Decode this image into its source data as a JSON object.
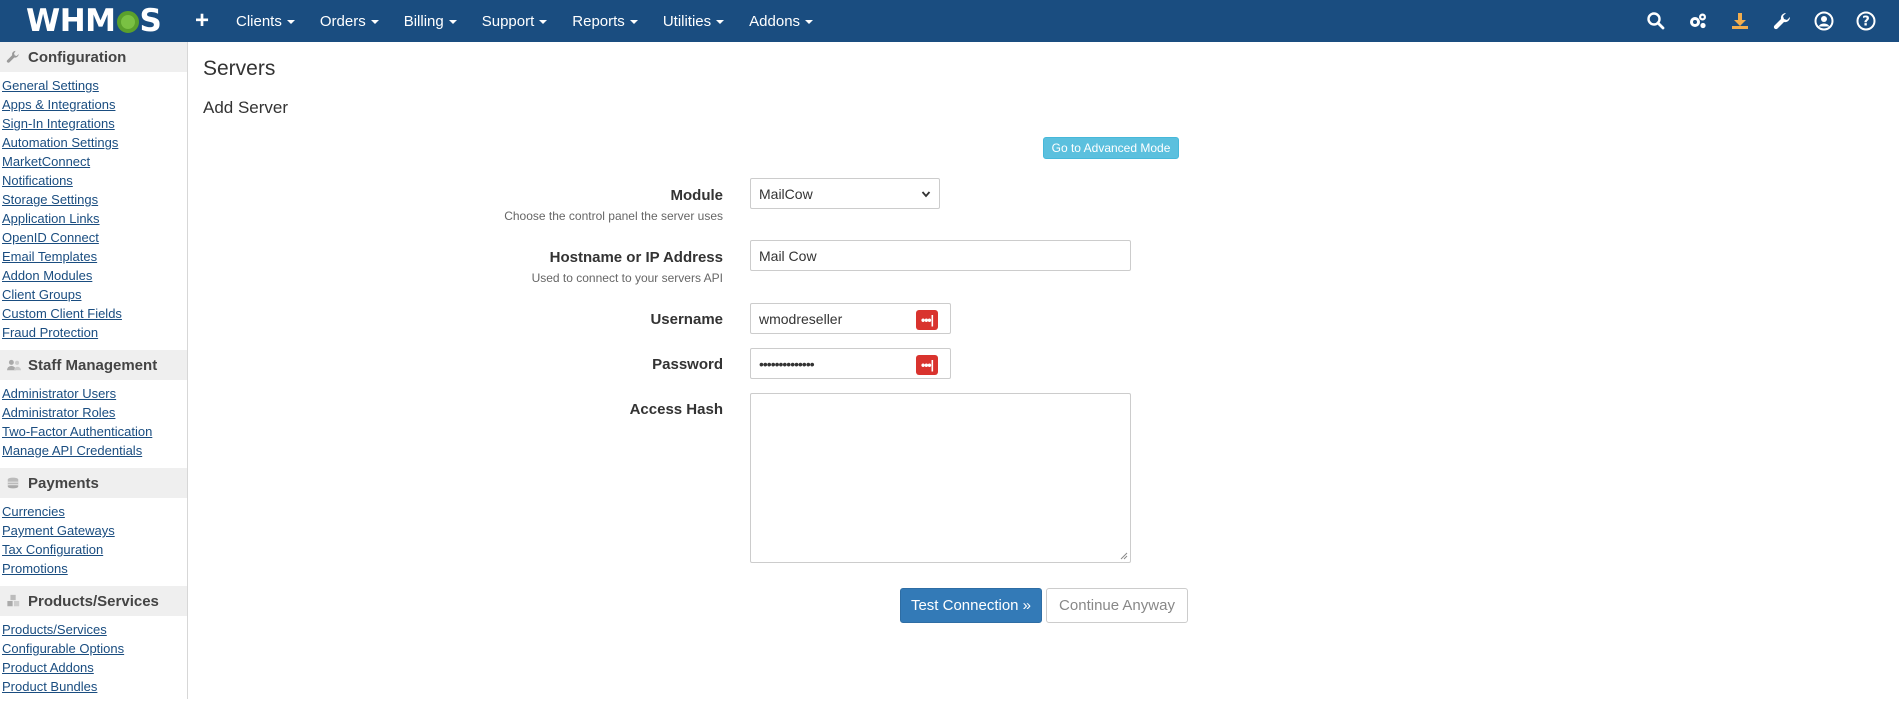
{
  "header": {
    "logo": {
      "prefix": "WHM",
      "suffix": "S"
    },
    "plus_icon": "plus-icon",
    "menu": [
      {
        "label": "Clients"
      },
      {
        "label": "Orders"
      },
      {
        "label": "Billing"
      },
      {
        "label": "Support"
      },
      {
        "label": "Reports"
      },
      {
        "label": "Utilities"
      },
      {
        "label": "Addons"
      }
    ],
    "icons": [
      "search-icon",
      "gears-icon",
      "download-icon",
      "wrench-icon",
      "user-icon",
      "help-icon"
    ]
  },
  "sidebar": {
    "sections": [
      {
        "title": "Configuration",
        "icon": "wrench-icon",
        "links": [
          "General Settings",
          "Apps & Integrations",
          "Sign-In Integrations",
          "Automation Settings",
          "MarketConnect",
          "Notifications",
          "Storage Settings",
          "Application Links",
          "OpenID Connect",
          "Email Templates",
          "Addon Modules",
          "Client Groups",
          "Custom Client Fields",
          "Fraud Protection"
        ]
      },
      {
        "title": "Staff Management",
        "icon": "users-icon",
        "links": [
          "Administrator Users",
          "Administrator Roles",
          "Two-Factor Authentication",
          "Manage API Credentials"
        ]
      },
      {
        "title": "Payments",
        "icon": "coins-icon",
        "links": [
          "Currencies",
          "Payment Gateways",
          "Tax Configuration",
          "Promotions"
        ]
      },
      {
        "title": "Products/Services",
        "icon": "cubes-icon",
        "links": [
          "Products/Services",
          "Configurable Options",
          "Product Addons",
          "Product Bundles"
        ]
      }
    ]
  },
  "main": {
    "title": "Servers",
    "subtitle": "Add Server",
    "advanced_button": "Go to Advanced Mode",
    "form": {
      "module": {
        "label": "Module",
        "help": "Choose the control panel the server uses",
        "value": "MailCow"
      },
      "hostname": {
        "label": "Hostname or IP Address",
        "help": "Used to connect to your servers API",
        "value": "Mail Cow"
      },
      "username": {
        "label": "Username",
        "value": "wmodreseller"
      },
      "password": {
        "label": "Password",
        "value": "••••••••••••••"
      },
      "access_hash": {
        "label": "Access Hash",
        "value": ""
      }
    },
    "test_button": "Test Connection »",
    "continue_button": "Continue Anyway"
  },
  "colors": {
    "topbar": "#1a4d80",
    "primary": "#337ab7",
    "info": "#5bc0de",
    "danger": "#d9332e"
  }
}
